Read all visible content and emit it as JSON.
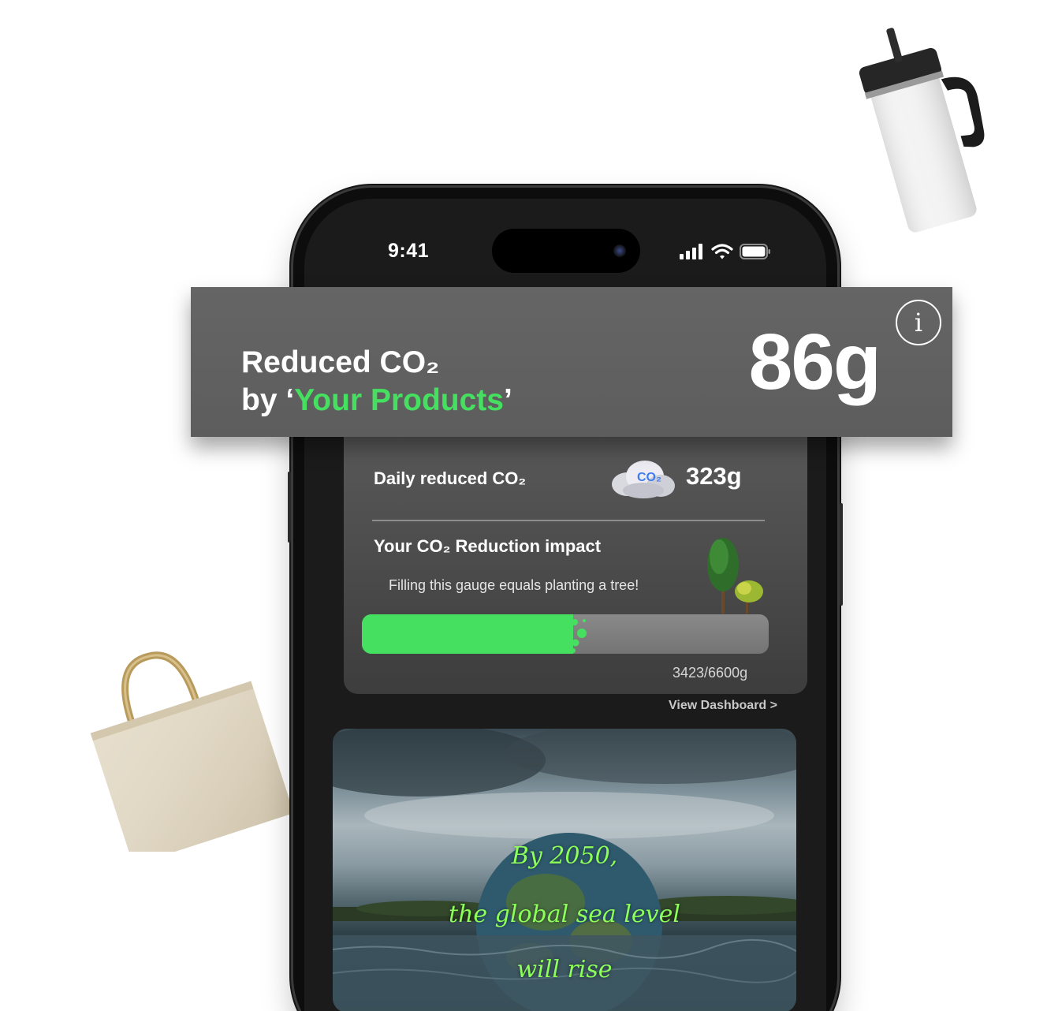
{
  "status_bar": {
    "time": "9:41"
  },
  "banner": {
    "line1": "Reduced CO₂",
    "line2_prefix": "by ‘",
    "line2_highlight": "Your Products",
    "line2_suffix": "’",
    "value": "86g",
    "info_icon": "i"
  },
  "stats": {
    "daily_label": "Daily reduced CO₂",
    "daily_value": "323g",
    "impact_title": "Your CO₂ Reduction impact",
    "impact_subtitle": "Filling this gauge equals planting a tree!",
    "gauge": {
      "current": 3423,
      "max": 6600,
      "label": "3423/6600g"
    },
    "view_dashboard": "View Dashboard  >"
  },
  "promo": {
    "lines": [
      "By 2050,",
      "the global sea level",
      "will rise"
    ]
  },
  "colors": {
    "accent_green": "#45e05f",
    "promo_text": "#8cff5a"
  },
  "icons": {
    "signal": "signal-icon",
    "wifi": "wifi-icon",
    "battery": "battery-icon",
    "info": "info-icon",
    "cloud": "co2-cloud-icon",
    "trees": "tree-icon"
  }
}
